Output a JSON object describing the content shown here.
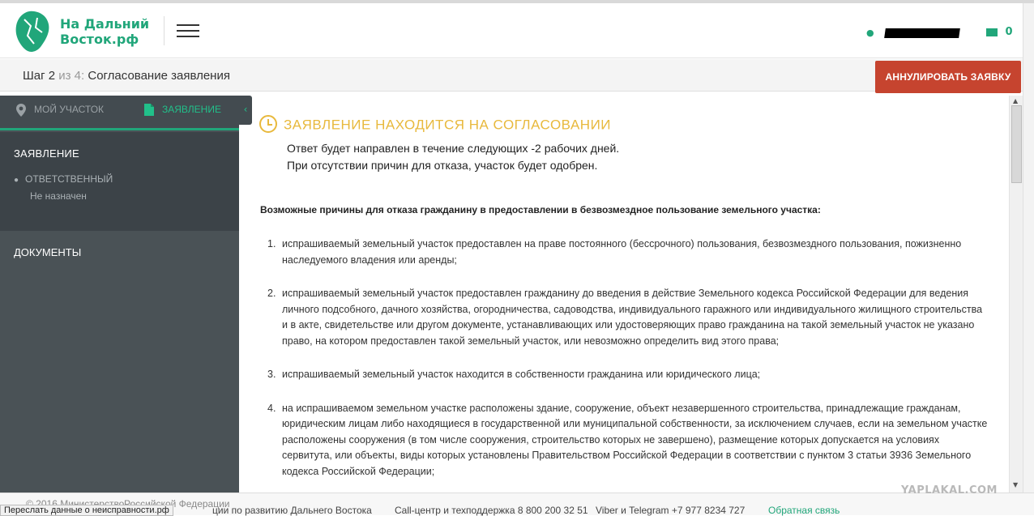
{
  "header": {
    "brand_line1": "На Дальний",
    "brand_line2": "Восток.рф",
    "mail_count": "0"
  },
  "stepbar": {
    "step_prefix": "Шаг 2",
    "step_of": " из 4:",
    "step_name": "Согласование заявления",
    "cancel_label": "АННУЛИРОВАТЬ ЗАЯВКУ"
  },
  "sidebar": {
    "tab_plot": "МОЙ УЧАСТОК",
    "tab_application": "ЗАЯВЛЕНИЕ",
    "collapse_glyph": "‹",
    "section_title": "ЗАЯВЛЕНИЕ",
    "responsible_label": "ОТВЕТСТВЕННЫЙ",
    "responsible_value": "Не назначен",
    "documents_label": "ДОКУМЕНТЫ"
  },
  "main": {
    "status_title": "ЗАЯВЛЕНИЕ НАХОДИТСЯ НА СОГЛАСОВАНИИ",
    "status_line1": "Ответ будет направлен в течение следующих -2 рабочих дней.",
    "status_line2": "При отсутствии причин для отказа, участок будет одобрен.",
    "reasons_title": "Возможные причины для отказа гражданину в предоставлении в безвозмездное пользование земельного участка:",
    "reasons": [
      {
        "num": "1.",
        "text": "испрашиваемый земельный участок предоставлен на праве постоянного (бессрочного) пользования, безвозмездного пользования, пожизненно наследуемого владения или аренды;"
      },
      {
        "num": "2.",
        "text": "испрашиваемый земельный участок предоставлен гражданину до введения в действие Земельного кодекса Российской Федерации для ведения личного подсобного, дачного хозяйства, огородничества, садоводства, индивидуального гаражного или индивидуального жилищного строительства и в акте, свидетельстве или другом документе, устанавливающих или удостоверяющих право гражданина на такой земельный участок не указано право, на котором предоставлен такой земельный участок, или невозможно определить вид этого права;"
      },
      {
        "num": "3.",
        "text": "испрашиваемый земельный участок находится в собственности гражданина или юридического лица;"
      },
      {
        "num": "4.",
        "text": "на испрашиваемом земельном участке расположены здание, сооружение, объект незавершенного строительства, принадлежащие гражданам, юридическим лицам либо находящиеся в государственной или муниципальной собственности, за исключением случаев, если на земельном участке расположены сооружения (в том числе сооружения, строительство которых не завершено), размещение которых допускается на условиях сервитута, или объекты, виды которых установлены Правительством Российской Федерации в соответствии с пунктом 3 статьи 39З6 Земельного кодекса Российской Федерации;"
      }
    ]
  },
  "footer": {
    "part1": "© 2016 Министерство",
    "part2": "Российской Федерации",
    "part3": "ции по развитию Дальнего Востока",
    "part4": "Call-центр и техподдержка 8 800 200 32 51",
    "part5": "Viber и Telegram +7 977 8234 727",
    "feedback": "Обратная связь",
    "tooltip": "Переслать данные о неисправности.рф"
  },
  "watermark": "YAPLAKAL.COM",
  "colors": {
    "brand": "#21a67a",
    "accent_status": "#e8b93d",
    "cancel_button": "#c6442f",
    "sidebar_bg": "#4a5256"
  },
  "icons": {
    "logo": "leaf-map-logo",
    "menu": "hamburger-icon",
    "user": "person-icon",
    "mail": "envelope-icon",
    "plot": "map-pin-icon",
    "document": "document-icon",
    "status": "clock-icon"
  }
}
